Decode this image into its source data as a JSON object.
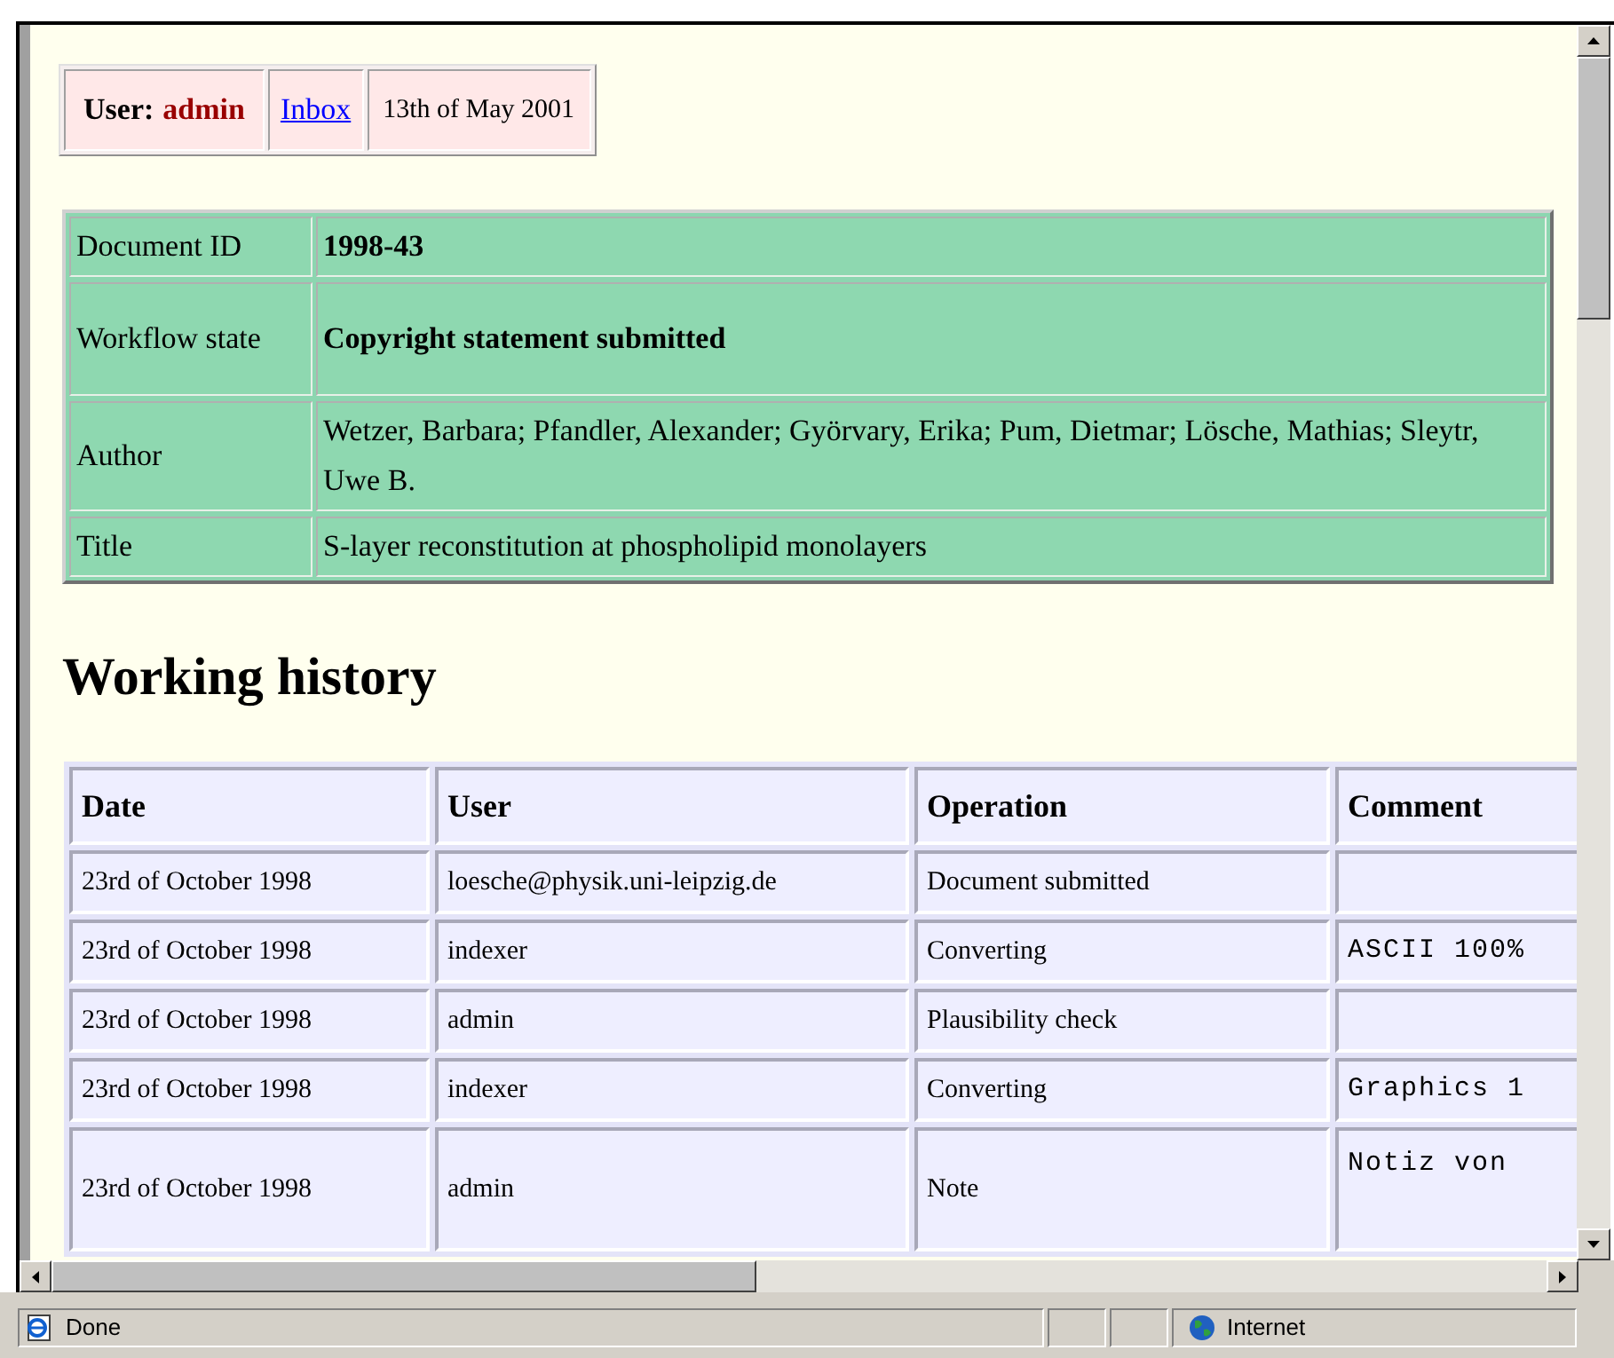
{
  "user_bar": {
    "label": "User:",
    "user": "admin",
    "link": "Inbox",
    "date": "13th of May 2001"
  },
  "document": {
    "rows": [
      {
        "label": "Document ID",
        "value": "1998-43",
        "bold": true
      },
      {
        "label": "Workflow state",
        "value": "Copyright statement submitted",
        "bold": true
      },
      {
        "label": "Author",
        "value": "Wetzer, Barbara; Pfandler, Alexander; Györvary, Erika; Pum, Dietmar; Lösche, Mathias; Sleytr, Uwe B.",
        "bold": false
      },
      {
        "label": "Title",
        "value": "S-layer reconstitution at phospholipid monolayers",
        "bold": false
      }
    ]
  },
  "history": {
    "heading": "Working history",
    "columns": [
      "Date",
      "User",
      "Operation",
      "Comment"
    ],
    "rows": [
      {
        "date": "23rd of October 1998",
        "user": "loesche@physik.uni-leipzig.de",
        "operation": "Document submitted"
      },
      {
        "date": "23rd of October 1998",
        "user": "indexer",
        "operation": "Converting",
        "comment": "ASCII 100%"
      },
      {
        "date": "23rd of October 1998",
        "user": "admin",
        "operation": "Plausibility check"
      },
      {
        "date": "23rd of October 1998",
        "user": "indexer",
        "operation": "Converting",
        "comment": "Graphics 1"
      },
      {
        "date": "23rd of October 1998",
        "user": "admin",
        "operation": "Note",
        "comment": "Notiz von"
      }
    ]
  },
  "status_bar": {
    "text": "Done",
    "zone": "Internet"
  }
}
